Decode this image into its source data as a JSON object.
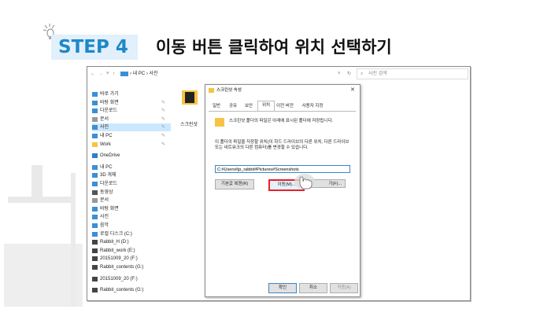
{
  "heading": {
    "step": "STEP 4",
    "title": "이동 버튼 클릭하여 위치 선택하기"
  },
  "colors": {
    "step_bg": "#e1f0fb",
    "step_text": "#1e88c7",
    "highlight": "#e8212a"
  },
  "explorer": {
    "path": "› 내 PC › 사진",
    "search_placeholder": "사진 검색",
    "sidebar": [
      {
        "label": "바로 가기",
        "icon": "star-icon",
        "pinned": false
      },
      {
        "label": "바탕 화면",
        "icon": "desktop-icon",
        "pinned": true
      },
      {
        "label": "다운로드",
        "icon": "download-icon",
        "pinned": true
      },
      {
        "label": "문서",
        "icon": "document-icon",
        "pinned": true
      },
      {
        "label": "사진",
        "icon": "picture-icon",
        "pinned": true,
        "selected": true
      },
      {
        "label": "내 PC",
        "icon": "pc-icon",
        "pinned": true
      },
      {
        "label": "Work",
        "icon": "folder-icon",
        "pinned": true
      },
      {
        "label": "OneDrive",
        "icon": "cloud-icon",
        "pinned": false
      },
      {
        "label": "내 PC",
        "icon": "pc-icon",
        "pinned": false
      },
      {
        "label": "3D 개체",
        "icon": "cube-icon",
        "pinned": false
      },
      {
        "label": "다운로드",
        "icon": "download-icon",
        "pinned": false
      },
      {
        "label": "동영상",
        "icon": "video-icon",
        "pinned": false
      },
      {
        "label": "문서",
        "icon": "document-icon",
        "pinned": false
      },
      {
        "label": "바탕 화면",
        "icon": "desktop-icon",
        "pinned": false
      },
      {
        "label": "사진",
        "icon": "picture-icon",
        "pinned": false
      },
      {
        "label": "음악",
        "icon": "music-icon",
        "pinned": false
      },
      {
        "label": "로컬 디스크 (C:)",
        "icon": "disk-icon",
        "pinned": false
      },
      {
        "label": "Rabbit_H (D:)",
        "icon": "drive-icon",
        "pinned": false
      },
      {
        "label": "Rabbit_work (E:)",
        "icon": "drive-icon",
        "pinned": false
      },
      {
        "label": "20151009_20 (F:)",
        "icon": "drive-icon",
        "pinned": false
      },
      {
        "label": "Rabbit_contents (G:)",
        "icon": "drive-icon",
        "pinned": false
      },
      {
        "label": "20151009_20 (F:)",
        "icon": "drive-icon",
        "pinned": false
      },
      {
        "label": "Rabbit_contents (G:)",
        "icon": "drive-icon",
        "pinned": false
      }
    ],
    "folder_label": "스크린샷"
  },
  "dialog": {
    "title": "스크린샷 속성",
    "tabs": [
      "일반",
      "공유",
      "보안",
      "위치",
      "이전 버전",
      "사용자 지정"
    ],
    "active_tab_index": 3,
    "info_text": "스크린샷 폴더의 파일은 아래에 표시된 폴더에 저장됩니다.",
    "desc_text": "이 폴더의 파일을 저장할 위치(이 하드 드라이브의 다른 위치, 다른 드라이브 또는 네트워크의 다른 컴퓨터)를 변경할 수 있습니다.",
    "path_value": "C:#Users#jp_rabbit#Pictures#Screenshots",
    "buttons": {
      "restore": "기본값 복원(R)",
      "move": "이동(M)...",
      "find": "대상 찾기(F)..."
    },
    "find_visible": "기(F)...",
    "footer": {
      "ok": "확인",
      "cancel": "취소",
      "apply": "적용(A)"
    }
  }
}
